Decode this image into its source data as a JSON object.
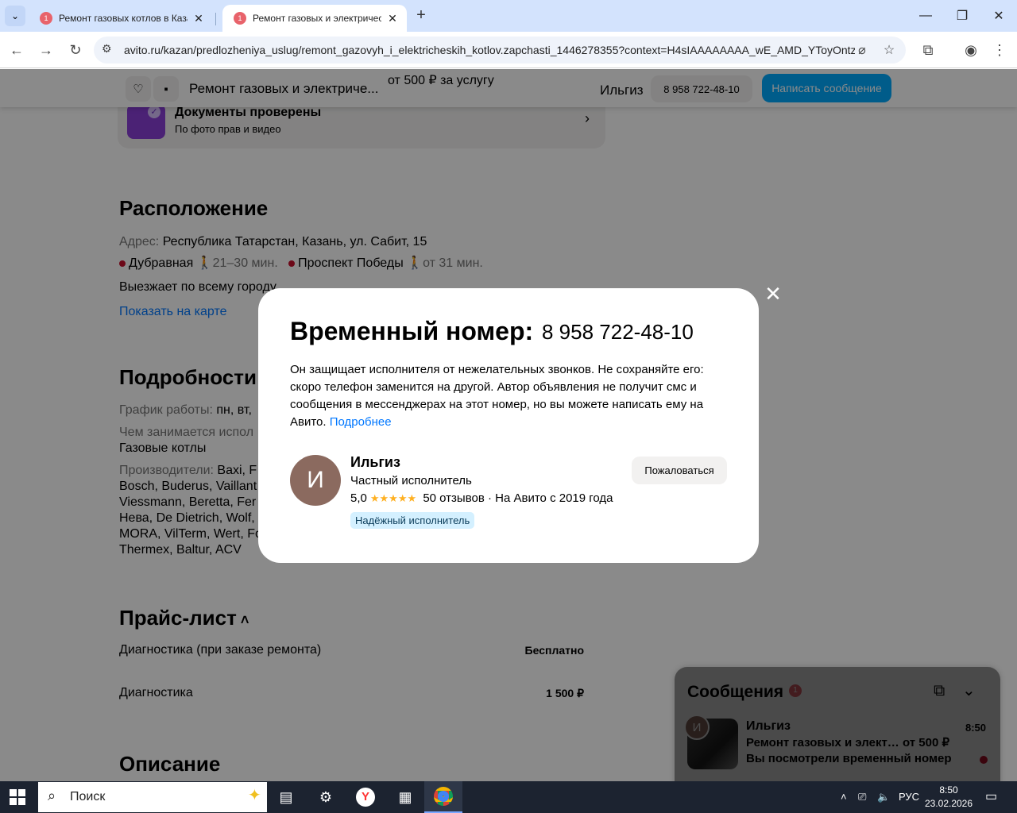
{
  "browser": {
    "tabs": [
      {
        "title": "Ремонт газовых котлов в Каза",
        "badge": "1"
      },
      {
        "title": "Ремонт газовых и электричеc",
        "badge": "1"
      }
    ],
    "url": "avito.ru/kazan/predlozheniya_uslug/remont_gazovyh_i_elektricheskih_kotlov.zapchasti_1446278355?context=H4sIAAAAAAAA_wE_AMD_YToyOntz..."
  },
  "sticky": {
    "title": "Ремонт газовых и электриче...",
    "price": "от 500 ₽ за услугу",
    "seller": "Ильгиз",
    "phone": "8 958 722-48-10",
    "message_button": "Написать сообщение"
  },
  "docs": {
    "title": "Документы проверены",
    "subtitle": "По фото прав и видео"
  },
  "location": {
    "heading": "Расположение",
    "address_label": "Адрес:",
    "address": "Республика Татарстан, Казань, ул. Сабит, 15",
    "metro": [
      {
        "name": "Дубравная",
        "time": "21–30 мин."
      },
      {
        "name": "Проспект Победы",
        "time": "от 31 мин."
      }
    ],
    "travel": "Выезжает по всему городу",
    "map_link": "Показать на карте"
  },
  "details": {
    "heading": "Подробности",
    "schedule_label": "График работы:",
    "schedule": "пн, вт,",
    "specialty_label": "Чем занимается испол",
    "specialty": "Газовые котлы",
    "brands_label": "Производители:",
    "brands_lines": [
      "Baxi, F",
      "Bosch, Buderus, Vaillant",
      "Viessmann, Beretta, Fer",
      "Нева, De Dietrich, Wolf,",
      "MORA, VilTerm, Wert, Fo",
      "Thermex, Baltur, ACV"
    ]
  },
  "pricelist": {
    "heading": "Прайс-лист",
    "rows": [
      {
        "name": "Диагностика (при заказе ремонта)",
        "price": "Бесплатно"
      },
      {
        "name": "Диагностика",
        "price": "1 500 ₽"
      }
    ]
  },
  "description_heading": "Описание",
  "modal": {
    "title": "Временный номер:",
    "phone": "8 958 722-48-10",
    "description": "Он защищает исполнителя от нежелательных звонков. Не сохраняйте его: скоро телефон заменится на другой. Автор объявления не получит смс и сообщения в мессенджерах на этот номер, но вы можете написать ему на Авито.",
    "more_link": "Подробнее",
    "avatar_letter": "И",
    "seller_name": "Ильгиз",
    "seller_role": "Частный исполнитель",
    "rating": "5,0",
    "stars": "★★★★★",
    "reviews": "50 отзывов",
    "since": "· На Авито с 2019 года",
    "badge": "Надёжный исполнитель",
    "report_button": "Пожаловаться"
  },
  "messenger": {
    "title": "Сообщения",
    "unread_count": "1",
    "chat": {
      "avatar_letter": "И",
      "name": "Ильгиз",
      "time": "8:50",
      "subject": "Ремонт газовых и элект…",
      "price": "от 500 ₽",
      "last_message": "Вы посмотрели временный номер"
    }
  },
  "taskbar": {
    "search_label": "Поиск",
    "language": "РУС",
    "time": "8:50",
    "date": "23.02.2026"
  },
  "colors": {
    "accent": "#00aaff",
    "link": "#0077ff",
    "badge": "#d4f0ff",
    "metro_dot": "#c8102e"
  }
}
